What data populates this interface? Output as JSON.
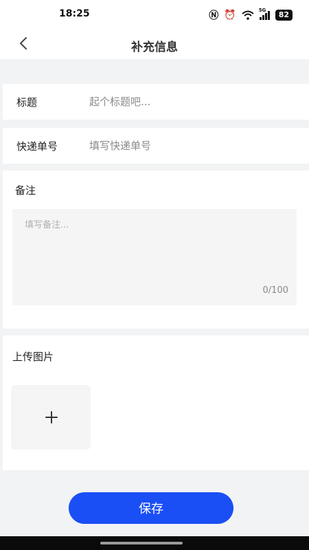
{
  "status_bar": {
    "time": "18:25",
    "network": "5G",
    "battery": "82",
    "icons": [
      "nfc-icon",
      "alarm-icon",
      "wifi-icon",
      "signal-icon",
      "battery-icon"
    ]
  },
  "nav": {
    "title": "补充信息",
    "back_icon": "chevron-left-icon"
  },
  "form": {
    "title_field": {
      "label": "标题",
      "value": "",
      "placeholder": "起个标题吧..."
    },
    "tracking_field": {
      "label": "快递单号",
      "value": "",
      "placeholder": "填写快递单号"
    },
    "remark": {
      "label": "备注",
      "value": "",
      "placeholder": "填写备注...",
      "counter": "0/100"
    },
    "upload": {
      "label": "上传图片",
      "add_icon": "plus-icon"
    }
  },
  "footer": {
    "save_label": "保存"
  },
  "colors": {
    "accent": "#1a4ff5",
    "background": "#f2f3f5",
    "card": "#ffffff",
    "input_bg": "#f5f5f5"
  }
}
